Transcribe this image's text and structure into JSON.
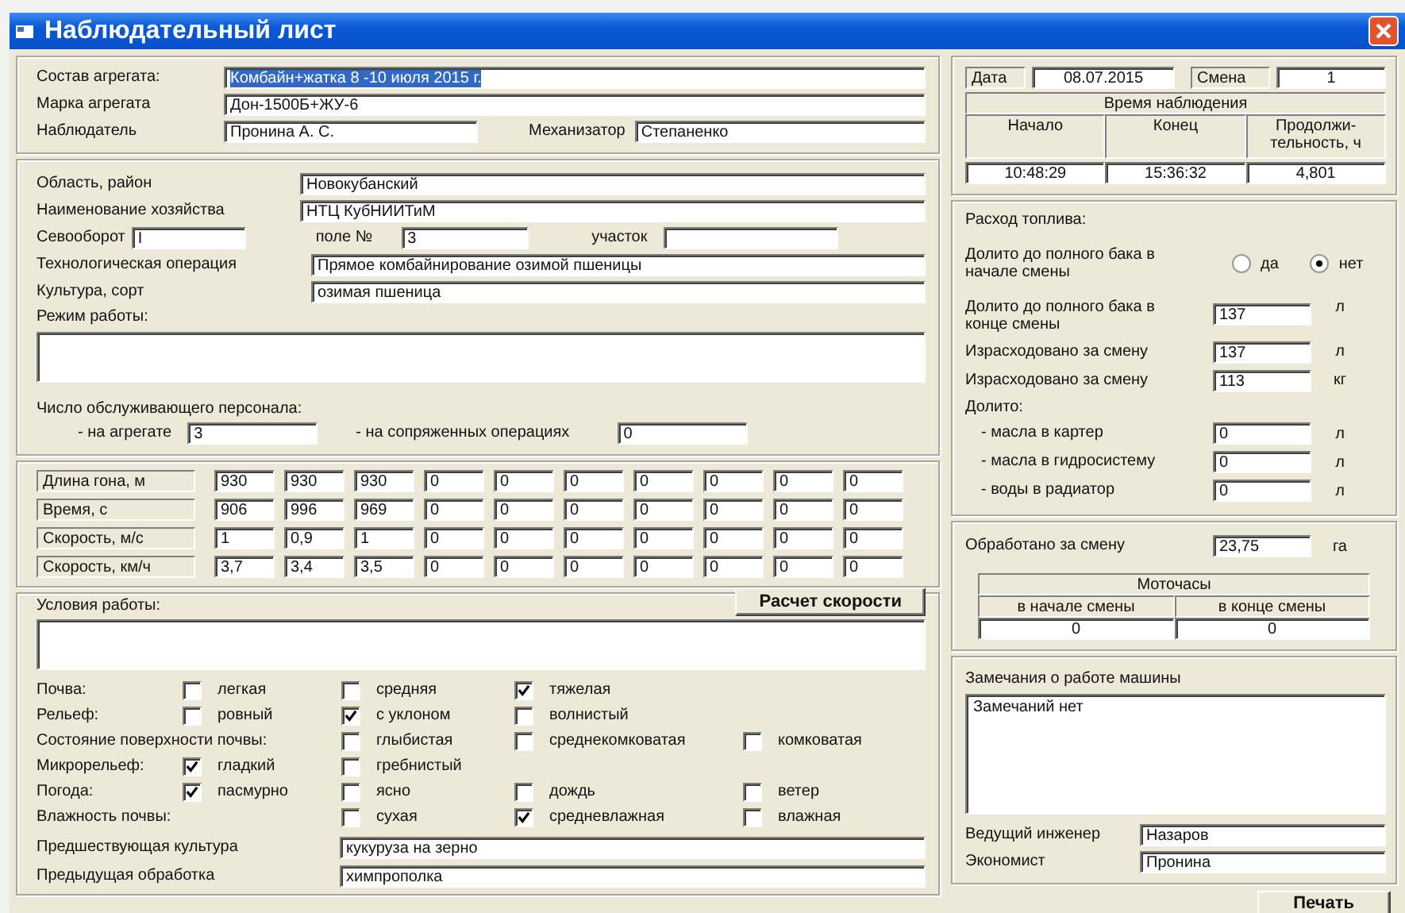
{
  "window": {
    "title": "Наблюдательный лист"
  },
  "aggregate": {
    "fields": [
      {
        "label": "Состав агрегата:",
        "value": "Комбайн+жатка 8 -10 июля 2015 г.",
        "highlighted": true
      },
      {
        "label": "Марка агрегата",
        "value": "Дон-1500Б+ЖУ-6",
        "highlighted": false
      }
    ],
    "observer": {
      "label": "Наблюдатель",
      "value": "Пронина  А. С."
    },
    "operator": {
      "label": "Механизатор",
      "value": "Степаненко"
    }
  },
  "site": {
    "region": {
      "label": "Область, район",
      "value": "Новокубанский"
    },
    "farm": {
      "label": "Наименование хозяйства",
      "value": "НТЦ КубНИИТиМ"
    },
    "rotation": {
      "label": "Севооборот",
      "value": "I"
    },
    "field_no": {
      "label": "поле №",
      "value": "3"
    },
    "plot": {
      "label": "участок"
    },
    "operation": {
      "label": "Технологическая операция",
      "value": "Прямое комбайнирование озимой пшеницы"
    },
    "crop": {
      "label": "Культура, сорт",
      "value": "озимая пшеница"
    },
    "work_mode": {
      "label": "Режим работы:"
    },
    "staff": {
      "label": "Число обслуживающего персонала:",
      "on_unit": {
        "label": "- на агрегате",
        "value": "3"
      },
      "on_related": {
        "label": "- на сопряженных операциях",
        "value": "0"
      }
    }
  },
  "measurements": {
    "rows": [
      {
        "label": "Длина  гона, м",
        "values": [
          "930",
          "930",
          "930",
          "0",
          "0",
          "0",
          "0",
          "0",
          "0",
          "0"
        ]
      },
      {
        "label": "Время, с",
        "values": [
          "906",
          "996",
          "969",
          "0",
          "0",
          "0",
          "0",
          "0",
          "0",
          "0"
        ]
      },
      {
        "label": "Скорость, м/с",
        "values": [
          "1",
          "0,9",
          "1",
          "0",
          "0",
          "0",
          "0",
          "0",
          "0",
          "0"
        ]
      },
      {
        "label": "Скорость, км/ч",
        "values": [
          "3,7",
          "3,4",
          "3,5",
          "0",
          "0",
          "0",
          "0",
          "0",
          "0",
          "0"
        ]
      }
    ]
  },
  "calc_button": "Расчет скорости",
  "conditions": {
    "label": "Условия работы:",
    "groups": [
      {
        "label": "Почва:",
        "indented": false,
        "options": [
          {
            "label": "легкая",
            "checked": false
          },
          {
            "label": "средняя",
            "checked": false
          },
          {
            "label": "тяжелая",
            "checked": true
          }
        ]
      },
      {
        "label": "Рельеф:",
        "indented": false,
        "options": [
          {
            "label": "ровный",
            "checked": false
          },
          {
            "label": "с уклоном",
            "checked": true
          },
          {
            "label": "волнистый",
            "checked": false
          }
        ]
      },
      {
        "label": "Состояние поверхности почвы:",
        "indented": true,
        "options": [
          {
            "label": "глыбистая",
            "checked": false
          },
          {
            "label": "среднекомковатая",
            "checked": false
          },
          {
            "label": "комковатая",
            "checked": false
          }
        ]
      },
      {
        "label": "Микрорельеф:",
        "indented": false,
        "options": [
          {
            "label": "гладкий",
            "checked": true
          },
          {
            "label": "гребнистый",
            "checked": false
          }
        ]
      },
      {
        "label": "Погода:",
        "indented": false,
        "options": [
          {
            "label": "пасмурно",
            "checked": true
          },
          {
            "label": "ясно",
            "checked": false
          },
          {
            "label": "дождь",
            "checked": false
          },
          {
            "label": "ветер",
            "checked": false
          }
        ]
      },
      {
        "label": "Влажность почвы:",
        "indented": true,
        "options": [
          {
            "label": "сухая",
            "checked": false
          },
          {
            "label": "средневлажная",
            "checked": true
          },
          {
            "label": "влажная",
            "checked": false
          }
        ]
      }
    ],
    "previous_crop": {
      "label": "Предшествующая культура",
      "value": "кукуруза на зерно"
    },
    "previous_treatment": {
      "label": "Предыдущая обработка",
      "value": "химпрополка"
    }
  },
  "shift_info": {
    "date": {
      "label": "Дата",
      "value": "08.07.2015"
    },
    "shift": {
      "label": "Смена",
      "value": "1"
    },
    "time": {
      "title": "Время наблюдения",
      "columns": [
        "Начало",
        "Конец",
        "Продолжи-тельность, ч"
      ],
      "values": [
        "10:48:29",
        "15:36:32",
        "4,801"
      ]
    }
  },
  "fuel": {
    "title": "Расход топлива:",
    "full_at_start": {
      "label": "Долито до полного бака в начале смены",
      "options": [
        {
          "label": "да",
          "selected": false
        },
        {
          "label": "нет",
          "selected": true
        }
      ]
    },
    "rows": [
      {
        "label": "Долито до полного бака в конце смены",
        "value": "137",
        "unit": "л"
      },
      {
        "label": "Израсходовано за смену",
        "value": "137",
        "unit": "л"
      },
      {
        "label": "Израсходовано за смену",
        "value": "113",
        "unit": "кг"
      }
    ],
    "topped_label": "Долито:",
    "topped": [
      {
        "label": "- масла в картер",
        "value": "0",
        "unit": "л"
      },
      {
        "label": "- масла в гидросистему",
        "value": "0",
        "unit": "л"
      },
      {
        "label": "- воды в радиатор",
        "value": "0",
        "unit": "л"
      }
    ]
  },
  "output": {
    "label": "Обработано за смену",
    "value": "23,75",
    "unit": "га",
    "hours": {
      "title": "Моточасы",
      "columns": [
        "в начале смены",
        "в конце смены"
      ],
      "values": [
        "0",
        "0"
      ]
    }
  },
  "remarks": {
    "label": "Замечания о работе машины",
    "value": "Замечаний нет",
    "lead_engineer": {
      "label": "Ведущий инженер",
      "value": "Назаров"
    },
    "economist": {
      "label": "Экономист",
      "value": "Пронина"
    }
  },
  "print_button": "Печать"
}
